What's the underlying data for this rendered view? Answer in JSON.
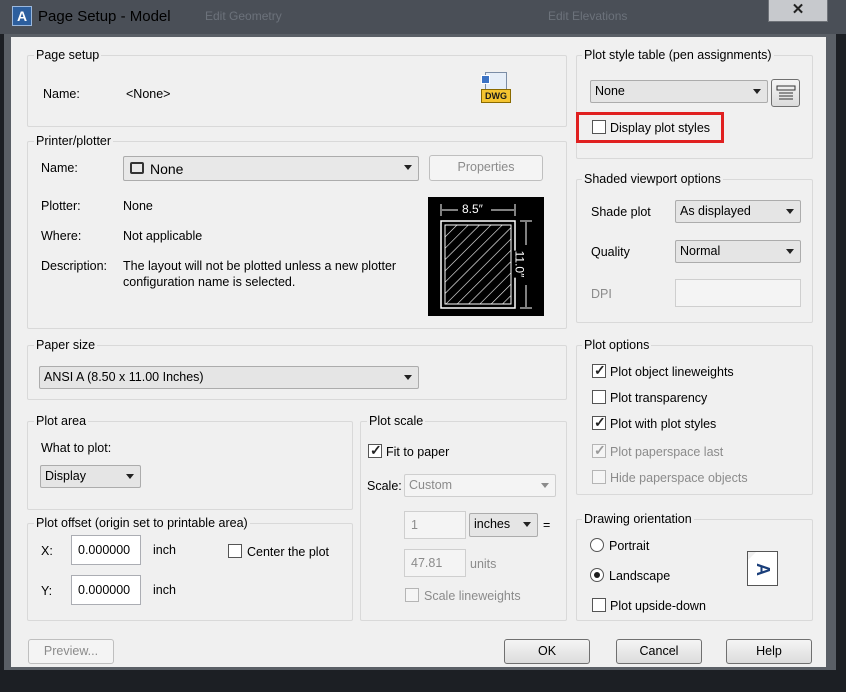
{
  "window": {
    "title": "Page Setup - Model",
    "app_icon_letter": "A",
    "background_tabs": [
      "Edit Geometry",
      "Edit Elevations"
    ],
    "close_glyph": "✕"
  },
  "page_setup": {
    "group_label": "Page setup",
    "name_label": "Name:",
    "name_value": "<None>",
    "dwg_badge": "DWG"
  },
  "printer": {
    "group_label": "Printer/plotter",
    "name_label": "Name:",
    "name_value": "None",
    "properties_button": "Properties",
    "plotter_label": "Plotter:",
    "plotter_value": "None",
    "where_label": "Where:",
    "where_value": "Not applicable",
    "description_label": "Description:",
    "description_line1": "The layout will not be plotted unless a new plotter",
    "description_line2": "configuration name is selected.",
    "preview_width_label": "8.5″",
    "preview_height_label": "11.0″"
  },
  "paper_size": {
    "group_label": "Paper size",
    "value": "ANSI A (8.50 x 11.00 Inches)"
  },
  "plot_area": {
    "group_label": "Plot area",
    "what_to_plot_label": "What to plot:",
    "what_to_plot_value": "Display"
  },
  "plot_offset": {
    "group_label": "Plot offset (origin set to printable area)",
    "x_label": "X:",
    "x_value": "0.000000",
    "x_unit": "inch",
    "y_label": "Y:",
    "y_value": "0.000000",
    "y_unit": "inch",
    "center_label": "Center the plot"
  },
  "plot_scale": {
    "group_label": "Plot scale",
    "fit_to_paper_label": "Fit to paper",
    "scale_label": "Scale:",
    "scale_value": "Custom",
    "ratio_value1": "1",
    "unit_select": "inches",
    "equals": "=",
    "ratio_value2": "47.81",
    "units_label": "units",
    "scale_lineweights_label": "Scale lineweights"
  },
  "plot_style_table": {
    "group_label": "Plot style table (pen assignments)",
    "value": "None",
    "display_plot_styles_label": "Display plot styles"
  },
  "shaded_viewport": {
    "group_label": "Shaded viewport options",
    "shade_plot_label": "Shade plot",
    "shade_plot_value": "As displayed",
    "quality_label": "Quality",
    "quality_value": "Normal",
    "dpi_label": "DPI"
  },
  "plot_options": {
    "group_label": "Plot options",
    "items": [
      {
        "label": "Plot object lineweights",
        "checked": true,
        "enabled": true
      },
      {
        "label": "Plot transparency",
        "checked": false,
        "enabled": true
      },
      {
        "label": "Plot with plot styles",
        "checked": true,
        "enabled": true
      },
      {
        "label": "Plot paperspace last",
        "checked": true,
        "enabled": false
      },
      {
        "label": "Hide paperspace objects",
        "checked": false,
        "enabled": false
      }
    ]
  },
  "orientation": {
    "group_label": "Drawing orientation",
    "portrait_label": "Portrait",
    "landscape_label": "Landscape",
    "selected": "Landscape",
    "upside_down_label": "Plot upside-down",
    "icon_letter": "A"
  },
  "footer": {
    "preview_button": "Preview...",
    "ok_button": "OK",
    "cancel_button": "Cancel",
    "help_button": "Help"
  },
  "colors": {
    "highlight": "#e02020",
    "dialog_bg": "#f0f0f0",
    "titlebar": "#4a4f57"
  }
}
